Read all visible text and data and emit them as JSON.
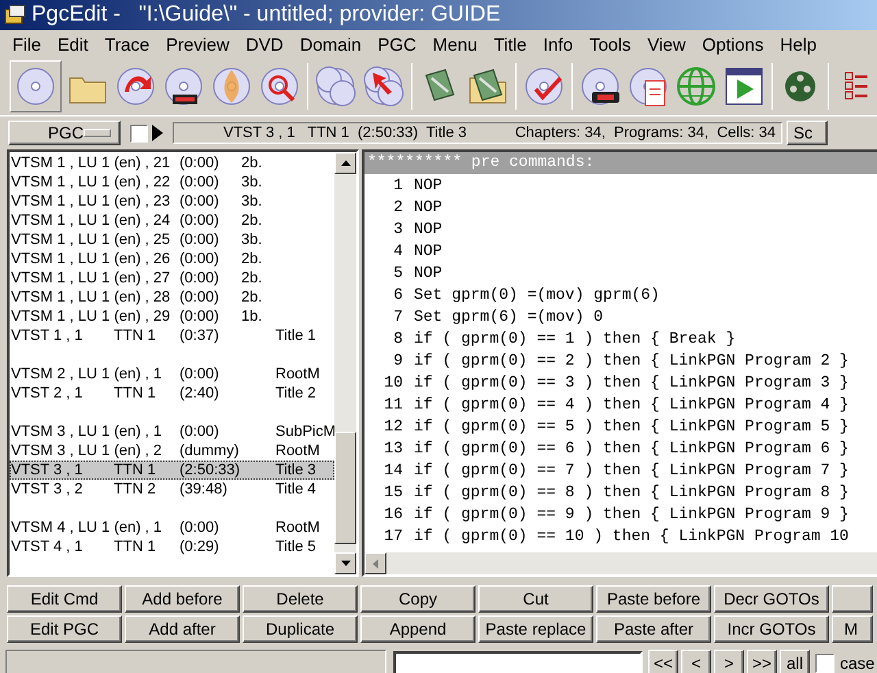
{
  "window": {
    "title": "PgcEdit -   \"I:\\Guide\\\" - untitled; provider: GUIDE"
  },
  "menu": [
    "File",
    "Edit",
    "Trace",
    "Preview",
    "DVD",
    "Domain",
    "PGC",
    "Menu",
    "Title",
    "Info",
    "Tools",
    "View",
    "Options",
    "Help"
  ],
  "infobar": {
    "domain_button": "PGC",
    "checkbox_checked": false,
    "current": "VTST 3 , 1   TTN 1  (2:50:33)  Title 3",
    "counts": "Chapters: 34,  Programs: 34,  Cells: 34",
    "cut_button": "Sc"
  },
  "pgc_list": {
    "groups": [
      {
        "rows": [
          {
            "c1": "VTSM 1 , LU 1 (en) , 21",
            "c2": "(0:00)",
            "c3": "2b.",
            "c4": "",
            "selected": false
          },
          {
            "c1": "VTSM 1 , LU 1 (en) , 22",
            "c2": "(0:00)",
            "c3": "3b.",
            "c4": "",
            "selected": false
          },
          {
            "c1": "VTSM 1 , LU 1 (en) , 23",
            "c2": "(0:00)",
            "c3": "3b.",
            "c4": "",
            "selected": false
          },
          {
            "c1": "VTSM 1 , LU 1 (en) , 24",
            "c2": "(0:00)",
            "c3": "2b.",
            "c4": "",
            "selected": false
          },
          {
            "c1": "VTSM 1 , LU 1 (en) , 25",
            "c2": "(0:00)",
            "c3": "3b.",
            "c4": "",
            "selected": false
          },
          {
            "c1": "VTSM 1 , LU 1 (en) , 26",
            "c2": "(0:00)",
            "c3": "2b.",
            "c4": "",
            "selected": false
          },
          {
            "c1": "VTSM 1 , LU 1 (en) , 27",
            "c2": "(0:00)",
            "c3": "2b.",
            "c4": "",
            "selected": false
          },
          {
            "c1": "VTSM 1 , LU 1 (en) , 28",
            "c2": "(0:00)",
            "c3": "2b.",
            "c4": "",
            "selected": false
          },
          {
            "c1": "VTSM 1 , LU 1 (en) , 29",
            "c2": "(0:00)",
            "c3": "1b.",
            "c4": "",
            "selected": false
          },
          {
            "c1": "VTST 1 , 1",
            "c1b": "TTN 1",
            "c2": "(0:37)",
            "c3": "",
            "c4": "Title 1",
            "selected": false
          }
        ]
      },
      {
        "rows": [
          {
            "c1": "VTSM 2 , LU 1 (en) , 1",
            "c2": "(0:00)",
            "c3": "",
            "c4": "RootM",
            "selected": false
          },
          {
            "c1": "VTST 2 , 1",
            "c1b": "TTN 1",
            "c2": "(2:40)",
            "c3": "",
            "c4": "Title 2",
            "selected": false
          }
        ]
      },
      {
        "rows": [
          {
            "c1": "VTSM 3 , LU 1 (en) , 1",
            "c2": "(0:00)",
            "c3": "",
            "c4": "SubPicM",
            "selected": false
          },
          {
            "c1": "VTSM 3 , LU 1 (en) , 2",
            "c2": "(dummy)",
            "c3": "",
            "c4": "RootM",
            "selected": false
          },
          {
            "c1": "VTST 3 , 1",
            "c1b": "TTN 1",
            "c2": "(2:50:33)",
            "c3": "",
            "c4": "Title 3",
            "selected": true
          },
          {
            "c1": "VTST 3 , 2",
            "c1b": "TTN 2",
            "c2": "(39:48)",
            "c3": "",
            "c4": "Title 4",
            "selected": false
          }
        ]
      },
      {
        "rows": [
          {
            "c1": "VTSM 4 , LU 1 (en) , 1",
            "c2": "(0:00)",
            "c3": "",
            "c4": "RootM",
            "selected": false
          },
          {
            "c1": "VTST 4 , 1",
            "c1b": "TTN 1",
            "c2": "(0:29)",
            "c3": "",
            "c4": "Title 5",
            "selected": false
          }
        ]
      }
    ]
  },
  "commands": {
    "header": "********** pre commands:",
    "lines": [
      {
        "n": "1",
        "text": "NOP"
      },
      {
        "n": "2",
        "text": "NOP"
      },
      {
        "n": "3",
        "text": "NOP"
      },
      {
        "n": "4",
        "text": "NOP"
      },
      {
        "n": "5",
        "text": "NOP"
      },
      {
        "n": "6",
        "text": "Set gprm(0) =(mov) gprm(6)"
      },
      {
        "n": "7",
        "text": "Set gprm(6) =(mov) 0"
      },
      {
        "n": "8",
        "text": "if ( gprm(0) == 1 ) then { Break }"
      },
      {
        "n": "9",
        "text": "if ( gprm(0) == 2 ) then { LinkPGN Program 2 }"
      },
      {
        "n": "10",
        "text": "if ( gprm(0) == 3 ) then { LinkPGN Program 3 }"
      },
      {
        "n": "11",
        "text": "if ( gprm(0) == 4 ) then { LinkPGN Program 4 }"
      },
      {
        "n": "12",
        "text": "if ( gprm(0) == 5 ) then { LinkPGN Program 5 }"
      },
      {
        "n": "13",
        "text": "if ( gprm(0) == 6 ) then { LinkPGN Program 6 }"
      },
      {
        "n": "14",
        "text": "if ( gprm(0) == 7 ) then { LinkPGN Program 7 }"
      },
      {
        "n": "15",
        "text": "if ( gprm(0) == 8 ) then { LinkPGN Program 8 }"
      },
      {
        "n": "16",
        "text": "if ( gprm(0) == 9 ) then { LinkPGN Program 9 }"
      },
      {
        "n": "17",
        "text": "if ( gprm(0) == 10 ) then { LinkPGN Program 10 "
      }
    ]
  },
  "button_rows": [
    [
      "Edit Cmd",
      "Add before",
      "Delete",
      "Copy",
      "Cut",
      "Paste before",
      "Decr GOTOs",
      ""
    ],
    [
      "Edit PGC",
      "Add after",
      "Duplicate",
      "Append",
      "Paste replace",
      "Paste after",
      "Incr GOTOs",
      "M"
    ]
  ],
  "find_bar": {
    "nav_buttons": [
      "<<",
      "<",
      ">",
      ">>",
      "all"
    ],
    "case_checked": false,
    "case_label": "case"
  }
}
